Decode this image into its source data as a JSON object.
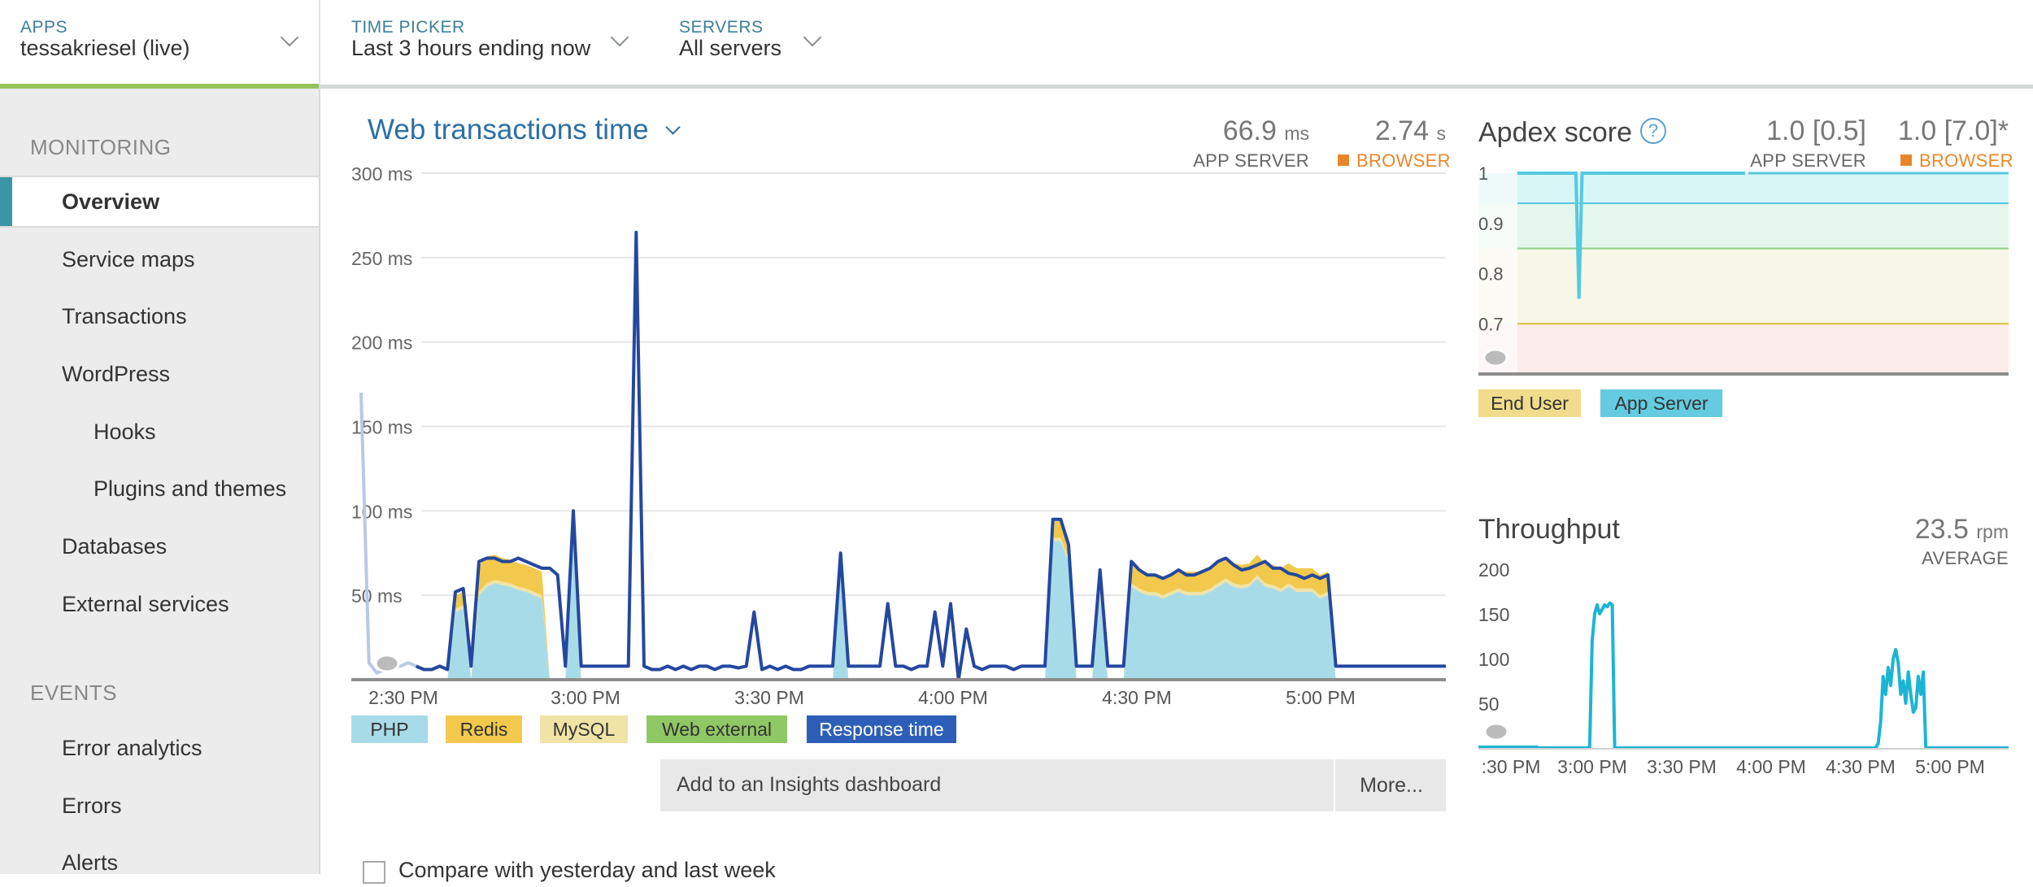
{
  "header": {
    "apps": {
      "label": "APPS",
      "value": "tessakriesel (live)"
    },
    "time_picker": {
      "label": "TIME PICKER",
      "value": "Last 3 hours ending now"
    },
    "servers": {
      "label": "SERVERS",
      "value": "All servers"
    }
  },
  "sidebar": {
    "sections": [
      {
        "title": "MONITORING",
        "items": [
          "Overview",
          "Service maps",
          "Transactions",
          "WordPress",
          "Hooks",
          "Plugins and themes",
          "Databases",
          "External services"
        ]
      },
      {
        "title": "EVENTS",
        "items": [
          "Error analytics",
          "Errors",
          "Alerts"
        ]
      }
    ],
    "active_item": "Overview"
  },
  "web_transactions": {
    "title": "Web transactions time",
    "app_server": {
      "value": "66.9",
      "unit": "ms",
      "label": "APP SERVER"
    },
    "browser": {
      "value": "2.74",
      "unit": "s",
      "label": "BROWSER"
    },
    "legend": [
      "PHP",
      "Redis",
      "MySQL",
      "Web external",
      "Response time"
    ],
    "insights_label": "Add to an Insights dashboard",
    "more_label": "More...",
    "compare_label": "Compare with yesterday and last week"
  },
  "apdex": {
    "title": "Apdex score",
    "help_icon": "question-icon",
    "app_server": {
      "value": "1.0 [0.5]",
      "label": "APP SERVER"
    },
    "browser": {
      "value": "1.0 [7.0]*",
      "label": "BROWSER"
    },
    "legend": [
      "End User",
      "App Server"
    ]
  },
  "throughput": {
    "title": "Throughput",
    "value": "23.5",
    "unit": "rpm",
    "label": "AVERAGE"
  },
  "colors": {
    "php": "#a8dbe8",
    "redis": "#f2c94c",
    "mysql": "#f0e3a6",
    "web_external": "#8fc865",
    "response_time": "#2448a0",
    "throughput_line": "#1bb5d4",
    "apdex_line": "#55c9df",
    "accent_green": "#93c35a",
    "nav_active": "#3b95a4",
    "browser_orange": "#e8872a"
  },
  "chart_data": [
    {
      "type": "area",
      "title": "Web transactions time",
      "xlabel": "",
      "ylabel": "",
      "y_ticks": [
        "300 ms",
        "250 ms",
        "200 ms",
        "150 ms",
        "100 ms",
        "50 ms"
      ],
      "ylim": [
        0,
        300
      ],
      "x_ticks": [
        "2:30 PM",
        "3:00 PM",
        "3:30 PM",
        "4:00 PM",
        "4:30 PM",
        "5:00 PM"
      ],
      "x_start": "2:25 PM",
      "x_end": "5:24 PM",
      "series": [
        {
          "name": "PHP",
          "values": [
            0,
            0,
            0,
            0,
            0,
            0,
            0,
            0,
            0,
            0,
            0,
            0,
            40,
            42,
            0,
            50,
            55,
            57,
            56,
            55,
            53,
            52,
            50,
            48,
            0,
            0,
            0,
            88,
            0,
            0,
            0,
            0,
            0,
            0,
            0,
            0,
            0,
            0,
            0,
            0,
            0,
            0,
            0,
            0,
            0,
            0,
            0,
            0,
            0,
            0,
            0,
            0,
            0,
            0,
            0,
            0,
            0,
            0,
            0,
            0,
            0,
            60,
            0,
            0,
            0,
            0,
            0,
            0,
            0,
            0,
            0,
            0,
            0,
            0,
            0,
            0,
            0,
            0,
            0,
            0,
            0,
            0,
            0,
            0,
            0,
            0,
            0,
            0,
            82,
            82,
            70,
            0,
            0,
            0,
            50,
            0,
            0,
            0,
            55,
            52,
            50,
            50,
            48,
            50,
            52,
            50,
            50,
            50,
            52,
            55,
            58,
            55,
            54,
            55,
            60,
            55,
            54,
            52,
            55,
            52,
            52,
            52,
            48,
            50,
            0,
            0,
            0,
            0,
            0,
            0,
            0,
            0,
            0,
            0,
            0,
            0,
            0,
            0,
            0
          ]
        },
        {
          "name": "Redis",
          "values": [
            0,
            0,
            0,
            0,
            0,
            0,
            0,
            0,
            0,
            0,
            0,
            0,
            8,
            8,
            0,
            16,
            16,
            15,
            14,
            14,
            14,
            14,
            14,
            14,
            0,
            0,
            0,
            5,
            0,
            0,
            0,
            0,
            0,
            0,
            0,
            0,
            0,
            0,
            0,
            0,
            0,
            0,
            0,
            0,
            0,
            0,
            0,
            0,
            0,
            0,
            0,
            0,
            0,
            0,
            0,
            0,
            0,
            0,
            0,
            0,
            0,
            4,
            0,
            0,
            0,
            0,
            0,
            0,
            0,
            0,
            0,
            0,
            0,
            0,
            0,
            0,
            0,
            0,
            0,
            0,
            0,
            0,
            0,
            0,
            0,
            0,
            0,
            0,
            10,
            10,
            8,
            0,
            0,
            0,
            5,
            0,
            0,
            0,
            12,
            12,
            10,
            10,
            10,
            10,
            10,
            12,
            12,
            12,
            12,
            12,
            12,
            12,
            12,
            12,
            12,
            12,
            12,
            12,
            12,
            12,
            12,
            12,
            12,
            12,
            0,
            0,
            0,
            0,
            0,
            0,
            0,
            0,
            0,
            0,
            0,
            0,
            0,
            0,
            0
          ]
        },
        {
          "name": "MySQL",
          "values": [
            0,
            0,
            0,
            0,
            0,
            0,
            0,
            0,
            0,
            0,
            0,
            0,
            2,
            2,
            0,
            2,
            2,
            2,
            2,
            2,
            2,
            2,
            2,
            2,
            0,
            0,
            0,
            2,
            0,
            0,
            0,
            0,
            0,
            0,
            0,
            0,
            0,
            0,
            0,
            0,
            0,
            0,
            0,
            0,
            0,
            0,
            0,
            0,
            0,
            0,
            0,
            0,
            0,
            0,
            0,
            0,
            0,
            0,
            0,
            0,
            0,
            2,
            0,
            0,
            0,
            0,
            0,
            0,
            0,
            0,
            0,
            0,
            0,
            0,
            0,
            0,
            0,
            0,
            0,
            0,
            0,
            0,
            0,
            0,
            0,
            0,
            0,
            0,
            2,
            2,
            2,
            0,
            0,
            0,
            2,
            0,
            0,
            0,
            2,
            2,
            2,
            2,
            2,
            2,
            2,
            2,
            2,
            2,
            2,
            2,
            2,
            2,
            2,
            2,
            2,
            2,
            2,
            2,
            2,
            2,
            2,
            2,
            2,
            2,
            0,
            0,
            0,
            0,
            0,
            0,
            0,
            0,
            0,
            0,
            0,
            0,
            0,
            0,
            0
          ]
        },
        {
          "name": "Response time",
          "values": [
            170,
            10,
            4,
            6,
            8,
            8,
            10,
            8,
            6,
            6,
            8,
            6,
            52,
            54,
            8,
            70,
            72,
            72,
            70,
            70,
            72,
            70,
            68,
            66,
            66,
            62,
            8,
            100,
            8,
            8,
            8,
            8,
            8,
            8,
            8,
            265,
            8,
            6,
            6,
            8,
            6,
            8,
            6,
            8,
            8,
            6,
            8,
            8,
            7,
            8,
            40,
            6,
            8,
            6,
            8,
            6,
            6,
            8,
            8,
            8,
            8,
            75,
            8,
            8,
            8,
            8,
            8,
            45,
            8,
            8,
            6,
            8,
            8,
            40,
            8,
            45,
            0,
            30,
            8,
            6,
            8,
            8,
            8,
            6,
            8,
            8,
            8,
            8,
            95,
            95,
            80,
            8,
            8,
            8,
            65,
            8,
            8,
            8,
            70,
            65,
            62,
            62,
            60,
            62,
            65,
            62,
            62,
            64,
            66,
            70,
            72,
            68,
            65,
            66,
            68,
            70,
            66,
            66,
            63,
            62,
            60,
            62,
            60,
            62,
            8,
            8,
            8,
            8,
            8,
            8,
            8,
            8,
            8,
            8,
            8,
            8,
            8,
            8,
            8
          ]
        }
      ],
      "grid": true
    },
    {
      "type": "line",
      "title": "Apdex score",
      "y_ticks": [
        "1",
        "0.9",
        "0.8",
        "0.7"
      ],
      "ylim": [
        0.6,
        1
      ],
      "thresholds": [
        0.94,
        0.85,
        0.7
      ],
      "series": [
        {
          "name": "App Server",
          "values": [
            1,
            1,
            1,
            1,
            1,
            1,
            1,
            1,
            1,
            1,
            1,
            1,
            1,
            1,
            1,
            1,
            1,
            1,
            1,
            1,
            0.75,
            1,
            1,
            1,
            1,
            1,
            1,
            1,
            1,
            1,
            1,
            1,
            1,
            1,
            1,
            1,
            1,
            1,
            1,
            1,
            1,
            1,
            1,
            1,
            1,
            1,
            1,
            1,
            1,
            1,
            1,
            1,
            1,
            1,
            1,
            1,
            1,
            1,
            1,
            1,
            1,
            1,
            1,
            1,
            1,
            1,
            1,
            1,
            1,
            1,
            1,
            1,
            1,
            1,
            1
          ]
        }
      ],
      "grid": true
    },
    {
      "type": "line",
      "title": "Throughput",
      "y_ticks": [
        "200",
        "150",
        "100",
        "50"
      ],
      "ylim": [
        0,
        200
      ],
      "x_ticks": [
        ":30 PM",
        "3:00 PM",
        "3:30 PM",
        "4:00 PM",
        "4:30 PM",
        "5:00 PM"
      ],
      "series": [
        {
          "name": "Throughput",
          "values": [
            0,
            0,
            0,
            0,
            0,
            0,
            0,
            0,
            0,
            0,
            0,
            0,
            0,
            0,
            0,
            0,
            0,
            0,
            0,
            0,
            0,
            0,
            120,
            150,
            160,
            150,
            155,
            160,
            158,
            162,
            160,
            0,
            0,
            0,
            0,
            0,
            0,
            0,
            0,
            0,
            0,
            0,
            0,
            0,
            0,
            0,
            0,
            0,
            0,
            0,
            0,
            0,
            0,
            0,
            0,
            0,
            0,
            0,
            0,
            0,
            0,
            0,
            0,
            0,
            0,
            0,
            0,
            0,
            0,
            0,
            0,
            0,
            0,
            0,
            0,
            0,
            0,
            0,
            0,
            0,
            0,
            0,
            0,
            0,
            0,
            0,
            0,
            0,
            0,
            0,
            0,
            0,
            0,
            0,
            0,
            0,
            0,
            0,
            0,
            0,
            0,
            0,
            0,
            0,
            0,
            0,
            0,
            0,
            0,
            0,
            0,
            0,
            0,
            0,
            0,
            0,
            0,
            0,
            0,
            0,
            0,
            0,
            0,
            0,
            0,
            0,
            0,
            0,
            0,
            0,
            0,
            0,
            0,
            0,
            0,
            0,
            5,
            30,
            80,
            60,
            90,
            70,
            100,
            110,
            95,
            60,
            75,
            50,
            85,
            60,
            40,
            45,
            80,
            60,
            85,
            0,
            0,
            0,
            0,
            0,
            0,
            0,
            0,
            0,
            0,
            0,
            0,
            0,
            0,
            0,
            0,
            0,
            0,
            0,
            0,
            0,
            0,
            0,
            0,
            0,
            0,
            0,
            0,
            0,
            0,
            0,
            0,
            0,
            0
          ]
        }
      ],
      "grid": false
    }
  ]
}
